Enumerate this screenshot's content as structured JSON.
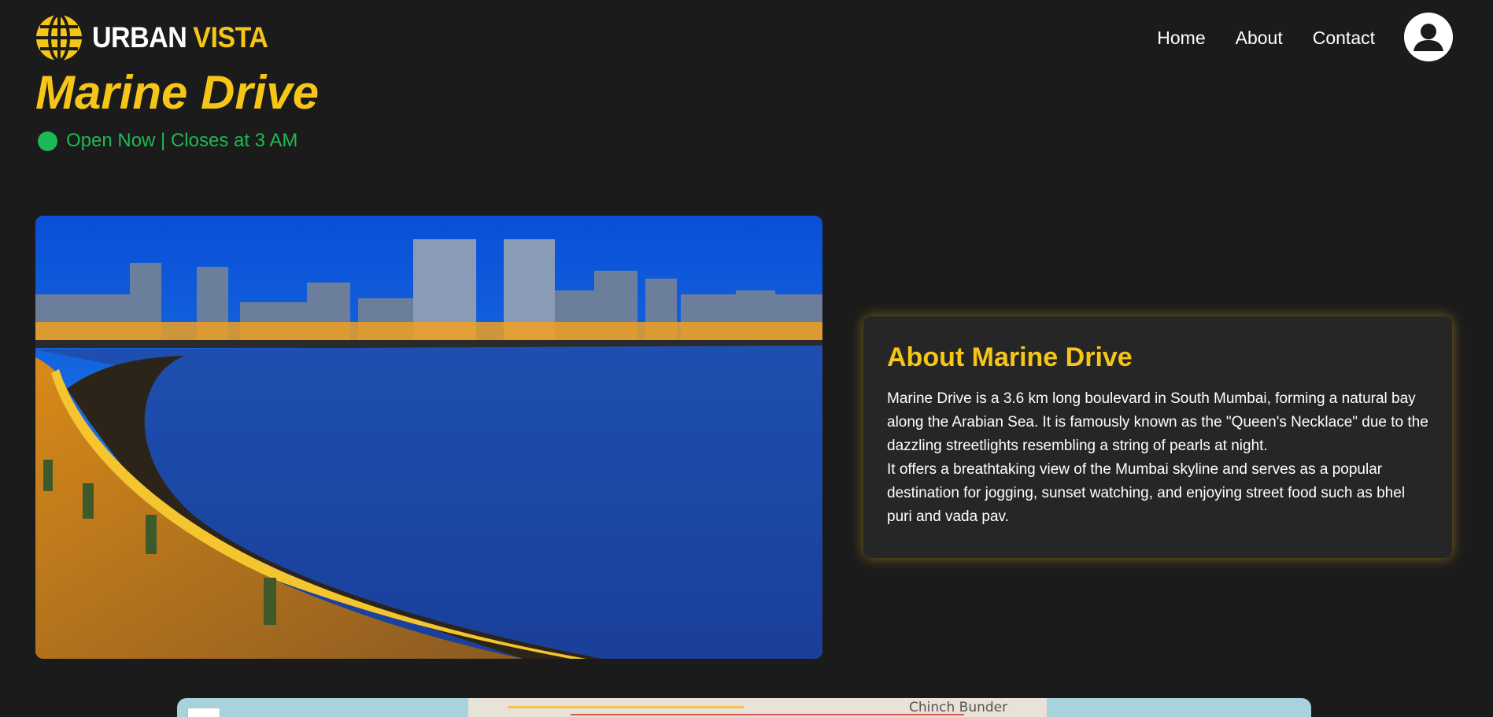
{
  "brand": {
    "name_part1": "URBAN",
    "name_part2": "VISTA",
    "accent_color": "#f5c518",
    "logo_icon": "globe-icon"
  },
  "nav": {
    "items": [
      {
        "label": "Home"
      },
      {
        "label": "About"
      },
      {
        "label": "Contact"
      }
    ],
    "profile_icon": "user-icon"
  },
  "place": {
    "title": "Marine Drive",
    "status_text": "Open Now | Closes at 3 AM",
    "status_color": "#1db954"
  },
  "about": {
    "heading": "About Marine Drive",
    "paragraph1": "Marine Drive is a 3.6 km long boulevard in South Mumbai, forming a natural bay along the Arabian Sea. It is famously known as the \"Queen's Necklace\" due to the dazzling streetlights resembling a string of pearls at night.",
    "paragraph2": "It offers a breathtaking view of the Mumbai skyline and serves as a popular destination for jogging, sunset watching, and enjoying street food such as bhel puri and vada pav."
  },
  "map": {
    "label": "Chinch Bunder"
  },
  "colors": {
    "background": "#1b1b1b",
    "card": "#262626"
  }
}
